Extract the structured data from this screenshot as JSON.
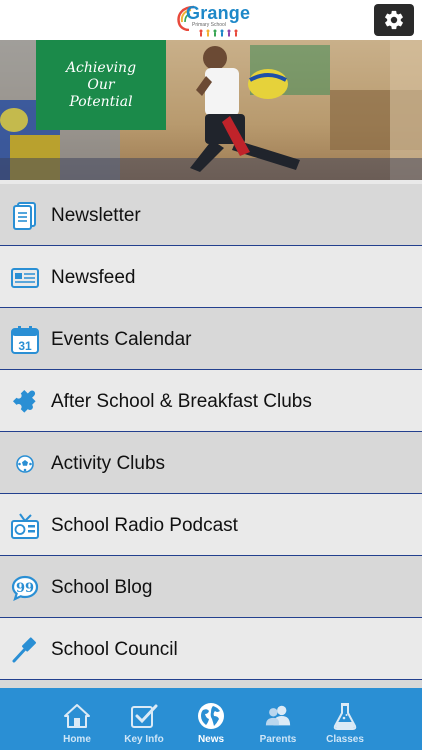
{
  "header": {
    "logo_name": "Grange",
    "logo_sub": "Primary School",
    "settings_icon": "gear-icon"
  },
  "hero": {
    "banner_lines": [
      "Achieving",
      "Our",
      "Potential"
    ]
  },
  "menu": {
    "items": [
      {
        "label": "Newsletter",
        "icon": "document-icon"
      },
      {
        "label": "Newsfeed",
        "icon": "newspaper-icon"
      },
      {
        "label": "Events Calendar",
        "icon": "calendar-icon",
        "icon_text": "31"
      },
      {
        "label": "After School & Breakfast Clubs",
        "icon": "puzzle-icon"
      },
      {
        "label": "Activity Clubs",
        "icon": "football-icon"
      },
      {
        "label": "School Radio Podcast",
        "icon": "radio-icon"
      },
      {
        "label": "School Blog",
        "icon": "speech-bubble-icon"
      },
      {
        "label": "School Council",
        "icon": "gavel-icon"
      }
    ]
  },
  "tabbar": {
    "tabs": [
      {
        "label": "Home",
        "icon": "home-icon"
      },
      {
        "label": "Key Info",
        "icon": "checkbox-icon"
      },
      {
        "label": "News",
        "icon": "globe-icon",
        "active": true
      },
      {
        "label": "Parents",
        "icon": "people-icon"
      },
      {
        "label": "Classes",
        "icon": "flask-icon"
      }
    ]
  },
  "colors": {
    "menu_icon": "#2a8fd4",
    "divider": "#23408e",
    "tabbar": "#2a8fd4",
    "banner": "#1b8a4a"
  }
}
